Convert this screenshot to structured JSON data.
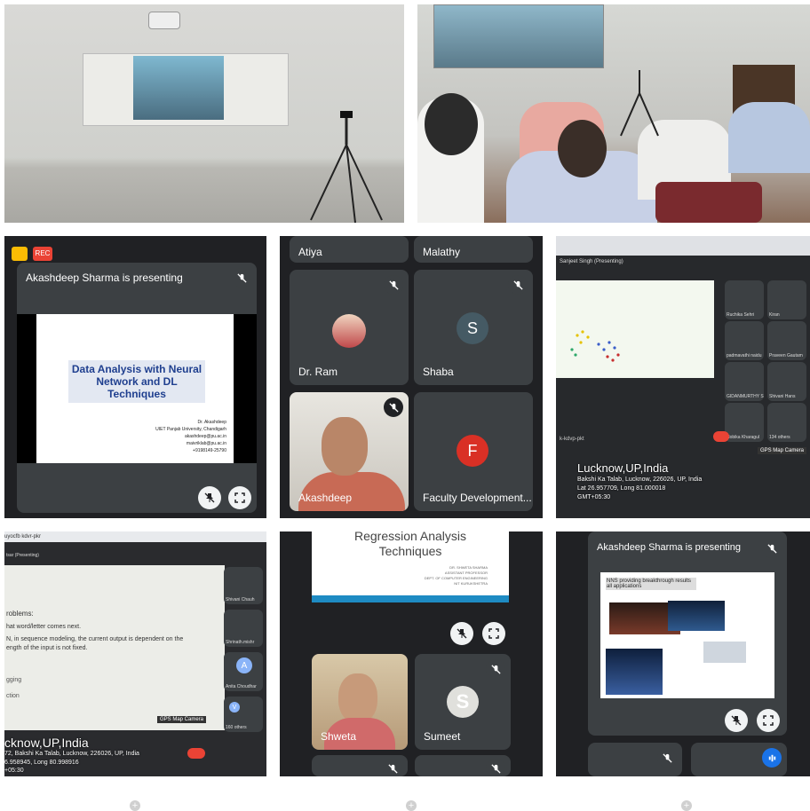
{
  "tile3": {
    "rec_label": "REC",
    "presenting": "Akashdeep Sharma is presenting",
    "slide_title": "Data Analysis with Neural Network and DL Techniques",
    "slide_lines": [
      "Dr. Akashdeep",
      "UIET Panjab University, Chandigarh",
      "akashdeep@pu.ac.in",
      "maivriklab@pu.ac.in",
      "+9198149-25790"
    ]
  },
  "tile4": {
    "names": [
      "Atiya",
      "Malathy",
      "Dr. Ram",
      "Shaba",
      "Akashdeep",
      "Faculty Development..."
    ],
    "shaba_initial": "S",
    "fd_initial": "F"
  },
  "tile5": {
    "presenter_bar": "Sanjeet Singh (Presenting)",
    "side": [
      "Ruchika Sehri",
      "Kiran",
      "padmavathi naidu",
      "Praveen Gautam",
      "GIDANMURTHY S",
      "Shivani Hans",
      "Nobika Kharagul",
      "134 others"
    ],
    "gps_city": "Lucknow,UP,India",
    "gps_addr": "Bakshi Ka Talab, Lucknow, 226026, UP, India",
    "gps_latlong": "Lat 26.957709, Long 81.000018",
    "gps_tz": "GMT+05:30",
    "gps_badge": "GPS Map Camera",
    "meet_code": "k-kdvp-pkt"
  },
  "tile6": {
    "url": "uyocfb kdvr-pkr",
    "presenting": "tsar (Presenting)",
    "lines": [
      "roblems:",
      "hat word/letter comes next.",
      "N, in sequence modeling, the current output is dependent on the",
      "ength of the input is not fixed.",
      "gging",
      "ction"
    ],
    "side": [
      "Shivani Chauh",
      "Shrinath.mishr",
      "Anita Choudhar",
      "160 others"
    ],
    "anita_initial": "A",
    "v_initial": "V",
    "gps_badge": "GPS Map Camera",
    "gps_city": "cknow,UP,India",
    "gps_addr": "72, Bakshi Ka Talab, Lucknow, 226026, UP, India",
    "gps_latlong": "6.958945, Long 80.998916",
    "gps_tz": "+05:30"
  },
  "tile7": {
    "slide_title1": "Regression Analysis",
    "slide_title2": "Techniques",
    "slide_lines": [
      "DR. SHWETA SHARMA",
      "ASSISTANT PROFESSOR",
      "DEPT. OF COMPUTER ENGINEERING",
      "NIT KURUKSHETRA"
    ],
    "names": [
      "Shweta",
      "Sumeet"
    ],
    "sumeet_initial": "S"
  },
  "tile8": {
    "presenting": "Akashdeep Sharma is presenting",
    "slide_heading": "NNS providing breakthrough results all applications"
  },
  "colors": {
    "meet_dark": "#202124",
    "rec_red": "#ea4335",
    "avatar_blue": "#1a73e8"
  }
}
